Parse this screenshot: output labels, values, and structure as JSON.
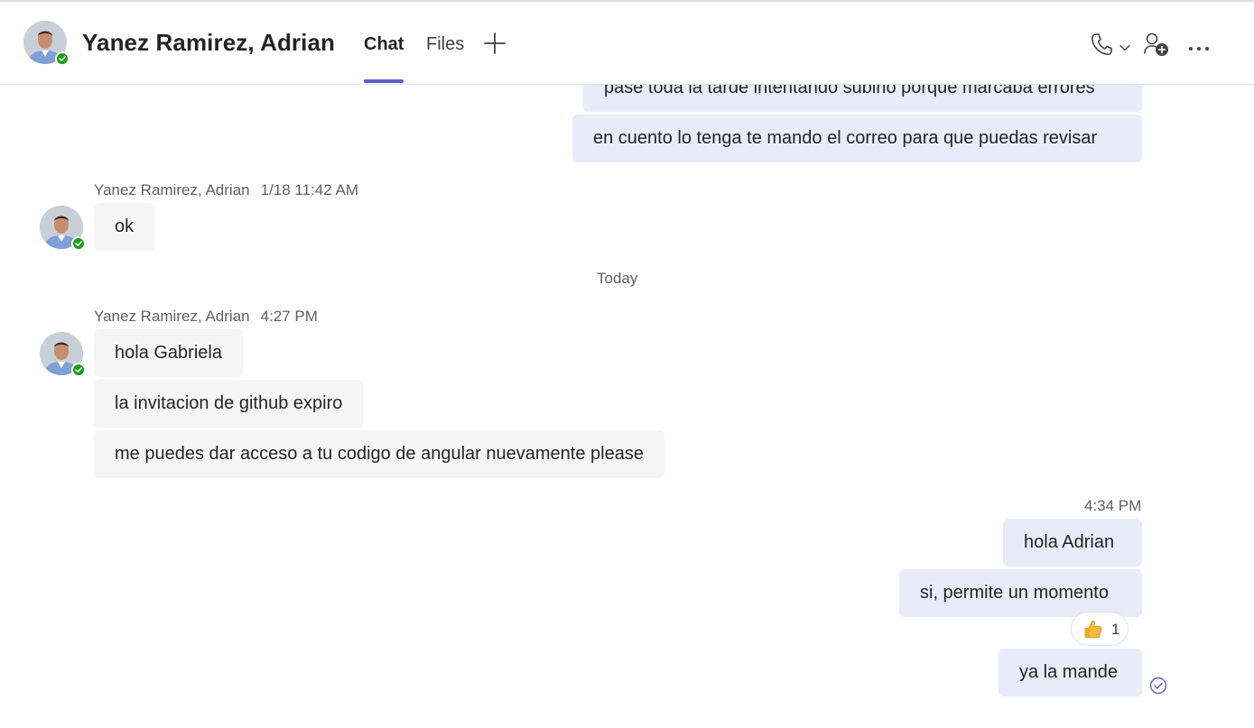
{
  "header": {
    "title": "Yanez Ramirez, Adrian",
    "tabs": [
      {
        "label": "Chat",
        "active": true
      },
      {
        "label": "Files",
        "active": false
      }
    ],
    "add_tab_icon": "plus-icon",
    "actions": [
      "phone-icon",
      "chevron-down-icon",
      "add-people-icon",
      "more-options-icon"
    ]
  },
  "messages": {
    "outgoing_top": [
      {
        "text": "pase toda la tarde intentando subirlo porque marcaba errores"
      },
      {
        "text": "en cuento lo tenga te mando el correo para que puedas revisar"
      }
    ],
    "group1": {
      "sender": "Yanez Ramirez, Adrian",
      "time": "1/18 11:42 AM",
      "messages": [
        {
          "text": "ok"
        }
      ]
    },
    "divider": "Today",
    "group2": {
      "sender": "Yanez Ramirez, Adrian",
      "time": "4:27 PM",
      "messages": [
        {
          "text": "hola Gabriela"
        },
        {
          "text": "la invitacion de github expiro"
        },
        {
          "text": "me puedes dar acceso a tu codigo de angular nuevamente please"
        }
      ]
    },
    "outgoing_group": {
      "time": "4:34 PM",
      "messages": [
        {
          "text": "hola Adrian"
        },
        {
          "text": "si, permite un momento"
        },
        {
          "text": "ya la mande"
        }
      ],
      "reaction": {
        "emoji": "thumbs-up-icon",
        "count": "1"
      },
      "status_icon": "read-receipt-icon"
    }
  },
  "colors": {
    "accent": "#5b5fc7",
    "incoming_bubble": "#f5f5f5",
    "outgoing_bubble": "#e8ebfa",
    "presence_available": "#13a10e"
  }
}
